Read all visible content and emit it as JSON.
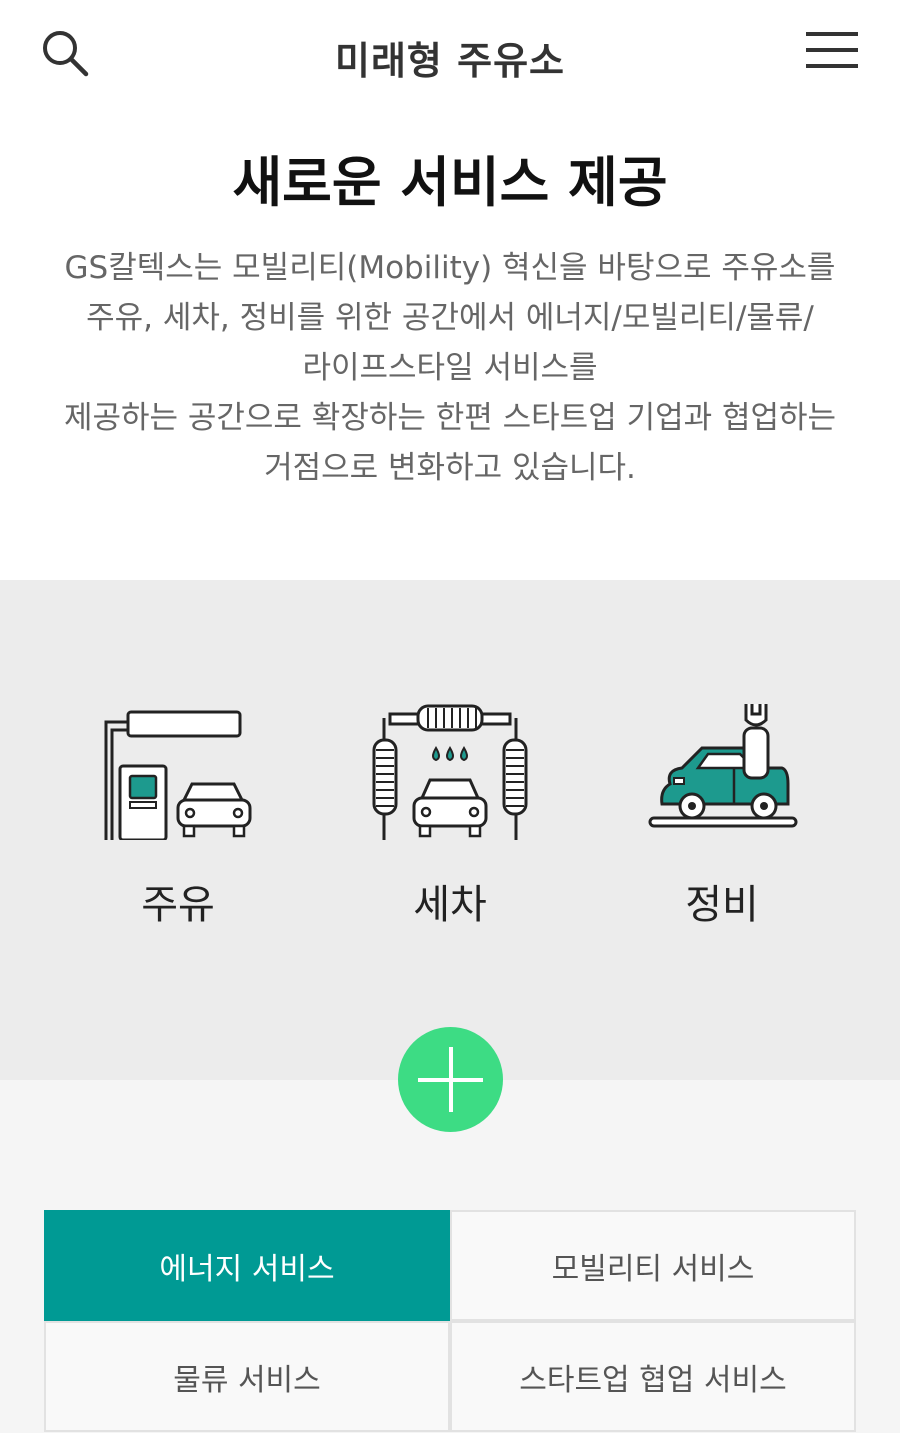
{
  "header": {
    "title": "미래형 주유소",
    "search_icon": "search-icon",
    "menu_icon": "hamburger-menu-icon"
  },
  "main": {
    "title": "새로운 서비스 제공",
    "intro_lines": [
      "GS칼텍스는 모빌리티(Mobility) 혁신을 바탕으로 주유소를",
      "주유, 세차, 정비를 위한 공간에서 에너지/모빌리티/물류/",
      "라이프스타일 서비스를",
      "제공하는 공간으로 확장하는 한편 스타트업 기업과 협업하는",
      "거점으로 변화하고 있습니다."
    ]
  },
  "services": [
    {
      "label": "주유",
      "icon": "fuel-pump-car-icon"
    },
    {
      "label": "세차",
      "icon": "car-wash-icon"
    },
    {
      "label": "정비",
      "icon": "car-repair-wrench-icon"
    }
  ],
  "plus_icon": "plus-icon",
  "tabs": [
    {
      "label": "에너지 서비스",
      "active": true
    },
    {
      "label": "모빌리티 서비스",
      "active": false
    },
    {
      "label": "물류 서비스",
      "active": false
    },
    {
      "label": "스타트업 협업 서비스",
      "active": false
    }
  ],
  "colors": {
    "accent_teal": "#009a94",
    "plus_green": "#3ddc84",
    "band_gray": "#ececec",
    "text_gray": "#666666"
  }
}
